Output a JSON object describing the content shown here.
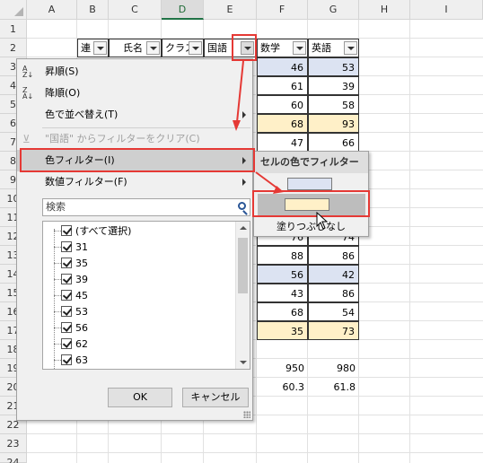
{
  "columns": [
    "A",
    "B",
    "C",
    "D",
    "E",
    "F",
    "G",
    "H",
    "I"
  ],
  "rows": [
    "1",
    "2",
    "3",
    "4",
    "5",
    "6",
    "7",
    "8",
    "9",
    "10",
    "11",
    "12",
    "13",
    "14",
    "15",
    "16",
    "17",
    "18",
    "19",
    "20",
    "21",
    "22",
    "23",
    "24"
  ],
  "selected_column": "D",
  "table_headers": {
    "b": "連",
    "c": "氏名",
    "d": "クラス",
    "e": "国語",
    "f": "数学",
    "g": "英語"
  },
  "visible_data": {
    "row3": {
      "f": "46",
      "g": "53"
    },
    "row4": {
      "f": "61",
      "g": "39"
    },
    "row5": {
      "f": "60",
      "g": "58"
    },
    "row6": {
      "f": "68",
      "g": "93"
    },
    "row7": {
      "f": "47",
      "g": "66"
    },
    "row12": {
      "f": "76",
      "g": "74"
    },
    "row13": {
      "f": "88",
      "g": "86"
    },
    "row14": {
      "f": "56",
      "g": "42"
    },
    "row15": {
      "f": "43",
      "g": "86"
    },
    "row16": {
      "f": "68",
      "g": "54"
    },
    "row17": {
      "f": "35",
      "g": "73"
    },
    "row19": {
      "f": "950",
      "g": "980"
    },
    "row20": {
      "f": "60.3",
      "g": "61.8"
    }
  },
  "menu": {
    "sort_asc": "昇順(S)",
    "sort_desc": "降順(O)",
    "sort_by_color": "色で並べ替え(T)",
    "clear_filter": "\"国語\" からフィルターをクリア(C)",
    "color_filter": "色フィルター(I)",
    "number_filter": "数値フィルター(F)",
    "search_placeholder": "検索",
    "list": [
      "(すべて選択)",
      "31",
      "35",
      "39",
      "45",
      "53",
      "56",
      "62",
      "63"
    ],
    "ok": "OK",
    "cancel": "キャンセル"
  },
  "submenu": {
    "header": "セルの色でフィルター",
    "no_fill": "塗りつぶしなし"
  },
  "colors": {
    "blue_fill": "#dce3f2",
    "yellow_fill": "#fff0c8",
    "highlight_red": "#e53935"
  }
}
